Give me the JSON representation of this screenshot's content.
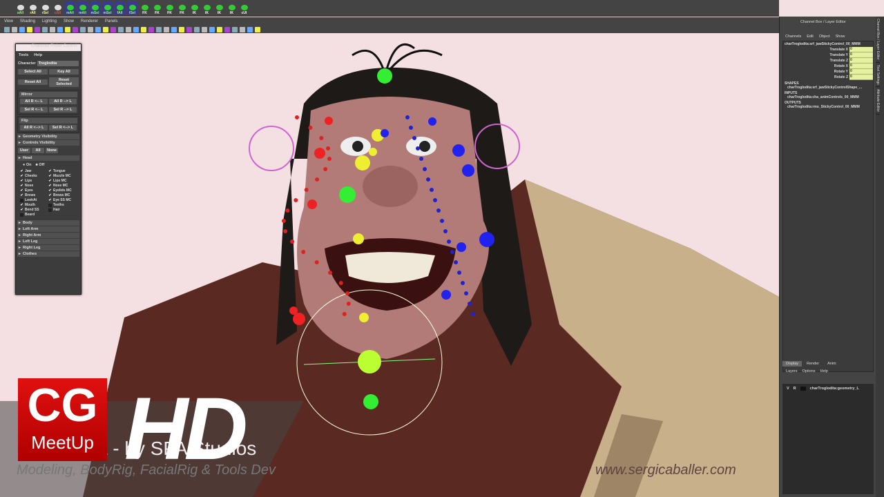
{
  "shelf": {
    "buttons": [
      {
        "label": "sAll",
        "color": "#9f6"
      },
      {
        "label": "rAll",
        "color": "#ff6"
      },
      {
        "label": "rSel",
        "color": "#ff6"
      },
      {
        "label": "cAll",
        "color": "#f44"
      },
      {
        "label": "mAll",
        "color": "#9f6"
      },
      {
        "label": "mAll",
        "color": "#9f6"
      },
      {
        "label": "mSel",
        "color": "#9f6"
      },
      {
        "label": "mSel",
        "color": "#9f6"
      },
      {
        "label": "fAll",
        "color": "#9f6"
      },
      {
        "label": "fSel",
        "color": "#9f6"
      },
      {
        "label": "FK",
        "color": "#fff"
      },
      {
        "label": "FK",
        "color": "#fff"
      },
      {
        "label": "FK",
        "color": "#fff"
      },
      {
        "label": "FK",
        "color": "#fff"
      },
      {
        "label": "IK",
        "color": "#fff"
      },
      {
        "label": "IK",
        "color": "#fff"
      },
      {
        "label": "IK",
        "color": "#fff"
      },
      {
        "label": "IK",
        "color": "#fff"
      },
      {
        "label": "cUI",
        "color": "#fff"
      }
    ]
  },
  "menubar": [
    "View",
    "Shading",
    "Lighting",
    "Show",
    "Renderer",
    "Panels"
  ],
  "picker": {
    "title": "Character Picker Control",
    "menu": [
      "Tools",
      "Help"
    ],
    "character_label": "Character",
    "character_value": "Troglodita",
    "buttons1": [
      "Select All",
      "Key All"
    ],
    "buttons2": [
      "Reset All",
      "Reset Selected"
    ],
    "mirror_title": "Mirror",
    "mirror1": [
      "All R <-- L",
      "All R --> L"
    ],
    "mirror2": [
      "Sel R <-- L",
      "Sel R --> L"
    ],
    "flip_title": "Flip",
    "flip": [
      "All R <--> L",
      "Sel R <--> L"
    ],
    "geometry": "Geometry Visibility",
    "controls": "Controls Visibility",
    "filters": [
      "User",
      "All",
      "None"
    ],
    "head": "Head",
    "on": "On",
    "off": "Off",
    "checks": [
      [
        "Jaw",
        true
      ],
      [
        "Tongue",
        true
      ],
      [
        "Cheeks",
        true
      ],
      [
        "Muzzle MC",
        true
      ],
      [
        "Lips",
        true
      ],
      [
        "Lips MC",
        true
      ],
      [
        "Nose",
        true
      ],
      [
        "Nose MC",
        true
      ],
      [
        "Eyes",
        true
      ],
      [
        "Eyelids MC",
        true
      ],
      [
        "Brows",
        true
      ],
      [
        "Brows MC",
        true
      ],
      [
        "LookAt",
        false
      ],
      [
        "Eye SS MC",
        true
      ],
      [
        "Mouth",
        true
      ],
      [
        "Teeths",
        false
      ],
      [
        "Bend SS",
        true
      ],
      [
        "Hair",
        false
      ],
      [
        "Beard",
        false
      ]
    ],
    "sections": [
      "Body",
      "Left Arm",
      "Right Arm",
      "Left Leg",
      "Right Leg",
      "Clothes"
    ]
  },
  "channelbox": {
    "title": "Channel Box / Layer Editor",
    "menu": [
      "Channels",
      "Edit",
      "Object",
      "Show"
    ],
    "object": "charTroglodita:srf_jawStickyControl_00_MMM",
    "channels": [
      {
        "name": "Translate X",
        "value": "0"
      },
      {
        "name": "Translate Y",
        "value": "0"
      },
      {
        "name": "Translate Z",
        "value": "0"
      },
      {
        "name": "Rotate X",
        "value": "0"
      },
      {
        "name": "Rotate Y",
        "value": "0"
      },
      {
        "name": "Rotate Z",
        "value": "0"
      }
    ],
    "shapes_label": "SHAPES",
    "shapes": "charTroglodita:srf_jawStickyControlShape_...",
    "inputs_label": "INPUTS",
    "inputs": "charTroglodita:cha_animControls_00_MMM",
    "outputs_label": "OUTPUTS",
    "outputs": "charTroglodita:rmu_StickyControl_00_MMM",
    "side_tabs": [
      "Channel Box / Layer Editor",
      "Tool Settings",
      "Attribute Editor"
    ]
  },
  "layers": {
    "tabs": [
      "Display",
      "Render",
      "Anim"
    ],
    "menu": [
      "Layers",
      "Options",
      "Help"
    ],
    "row": {
      "v": "V",
      "r": "R",
      "name": "charTroglodita:geometry_L"
    }
  },
  "overlay": {
    "logo_top": "CG",
    "logo_bottom": "MeetUp",
    "hd": "HD",
    "title": "Troglodita - by SPA Studios",
    "subtitle": "Modeling, BodyRig, FacialRig & Tools Dev",
    "website": "www.sergicaballer.com"
  }
}
